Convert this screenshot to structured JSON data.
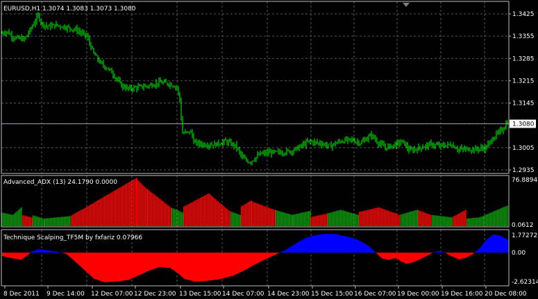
{
  "header": {
    "symbol_label": "EURUSD,H1  1.3074 1.3083 1.3073 1.3080"
  },
  "panes": {
    "adx": {
      "label": "Advanced_ADX (13) 24.1790 0.0000",
      "scale_top": "76.88945",
      "scale_bottom": "0.0612"
    },
    "scalping": {
      "label": "Technique Scalping_TF5M by fxfariz 0.07966",
      "scale_top": "1.77272",
      "scale_mid": "0.00",
      "scale_bottom": "-2.62314"
    }
  },
  "price_axis": {
    "ticks": [
      "1.3425",
      "1.3355",
      "1.3285",
      "1.3215",
      "1.3145",
      "1.3080",
      "1.3005",
      "1.2935"
    ],
    "current_price": "1.3080"
  },
  "time_axis": {
    "labels": [
      "8 Dec 2011",
      "9 Dec 14:00",
      "12 Dec 07:00",
      "12 Dec 23:00",
      "13 Dec 15:00",
      "14 Dec 07:00",
      "14 Dec 23:00",
      "15 Dec 15:00",
      "16 Dec 07:00",
      "19 Dec 00:00",
      "19 Dec 16:00",
      "20 Dec 08:00"
    ]
  },
  "colors": {
    "background": "#000000",
    "grid": "#5a5a5a",
    "candle": "#00ff00",
    "adx_up": "#00a000",
    "adx_down": "#ff0000",
    "scalp_pos": "#0000ff",
    "scalp_neg": "#ff0000",
    "text": "#ffffff"
  },
  "chart_data": [
    {
      "type": "candlestick",
      "title": "EURUSD,H1",
      "ylim": [
        1.2935,
        1.3425
      ],
      "close_path": [
        [
          0,
          1.3362
        ],
        [
          10,
          1.337
        ],
        [
          20,
          1.335
        ],
        [
          35,
          1.3345
        ],
        [
          45,
          1.338
        ],
        [
          55,
          1.342
        ],
        [
          60,
          1.3395
        ],
        [
          70,
          1.3385
        ],
        [
          80,
          1.339
        ],
        [
          95,
          1.3383
        ],
        [
          110,
          1.3375
        ],
        [
          125,
          1.3355
        ],
        [
          135,
          1.33
        ],
        [
          145,
          1.327
        ],
        [
          160,
          1.3245
        ],
        [
          175,
          1.32
        ],
        [
          185,
          1.319
        ],
        [
          200,
          1.3195
        ],
        [
          215,
          1.32
        ],
        [
          230,
          1.321
        ],
        [
          245,
          1.3205
        ],
        [
          255,
          1.3195
        ],
        [
          260,
          1.3145
        ],
        [
          262,
          1.305
        ],
        [
          275,
          1.3055
        ],
        [
          280,
          1.302
        ],
        [
          295,
          1.3015
        ],
        [
          310,
          1.3015
        ],
        [
          325,
          1.3025
        ],
        [
          340,
          1.301
        ],
        [
          350,
          1.297
        ],
        [
          360,
          1.296
        ],
        [
          375,
          1.2985
        ],
        [
          390,
          1.299
        ],
        [
          405,
          1.299
        ],
        [
          420,
          1.2995
        ],
        [
          430,
          1.3005
        ],
        [
          445,
          1.3025
        ],
        [
          460,
          1.302
        ],
        [
          475,
          1.301
        ],
        [
          490,
          1.3025
        ],
        [
          505,
          1.303
        ],
        [
          520,
          1.302
        ],
        [
          535,
          1.3045
        ],
        [
          545,
          1.302
        ],
        [
          555,
          1.3005
        ],
        [
          570,
          1.3015
        ],
        [
          580,
          1.3025
        ],
        [
          590,
          1.2995
        ],
        [
          605,
          1.3005
        ],
        [
          620,
          1.3015
        ],
        [
          635,
          1.301
        ],
        [
          650,
          1.3015
        ],
        [
          660,
          1.3
        ],
        [
          670,
          1.3
        ],
        [
          685,
          1.3
        ],
        [
          700,
          1.3005
        ],
        [
          712,
          1.304
        ],
        [
          720,
          1.3055
        ],
        [
          725,
          1.3065
        ],
        [
          732,
          1.309
        ]
      ]
    },
    {
      "type": "bar",
      "title": "Advanced_ADX (13)",
      "ylim": [
        0.0612,
        76.88945
      ],
      "segments": [
        {
          "from": 0,
          "to": 18,
          "color": "green",
          "v0": 22,
          "v1": 18
        },
        {
          "from": 18,
          "to": 30,
          "color": "green",
          "v0": 18,
          "v1": 30
        },
        {
          "from": 30,
          "to": 45,
          "color": "red",
          "v0": 18,
          "v1": 14
        },
        {
          "from": 45,
          "to": 62,
          "color": "green",
          "v0": 18,
          "v1": 12
        },
        {
          "from": 62,
          "to": 100,
          "color": "green",
          "v0": 12,
          "v1": 16
        },
        {
          "from": 100,
          "to": 120,
          "color": "red",
          "v0": 16,
          "v1": 28
        },
        {
          "from": 120,
          "to": 195,
          "color": "red",
          "v0": 28,
          "v1": 76
        },
        {
          "from": 195,
          "to": 210,
          "color": "red",
          "v0": 76,
          "v1": 60
        },
        {
          "from": 210,
          "to": 245,
          "color": "red",
          "v0": 60,
          "v1": 30
        },
        {
          "from": 245,
          "to": 262,
          "color": "green",
          "v0": 30,
          "v1": 22
        },
        {
          "from": 262,
          "to": 300,
          "color": "red",
          "v0": 30,
          "v1": 52
        },
        {
          "from": 300,
          "to": 330,
          "color": "red",
          "v0": 52,
          "v1": 24
        },
        {
          "from": 330,
          "to": 345,
          "color": "green",
          "v0": 24,
          "v1": 18
        },
        {
          "from": 345,
          "to": 360,
          "color": "red",
          "v0": 30,
          "v1": 40
        },
        {
          "from": 360,
          "to": 380,
          "color": "red",
          "v0": 40,
          "v1": 32
        },
        {
          "from": 380,
          "to": 395,
          "color": "red",
          "v0": 32,
          "v1": 26
        },
        {
          "from": 395,
          "to": 420,
          "color": "green",
          "v0": 26,
          "v1": 18
        },
        {
          "from": 420,
          "to": 445,
          "color": "green",
          "v0": 18,
          "v1": 24
        },
        {
          "from": 445,
          "to": 470,
          "color": "red",
          "v0": 14,
          "v1": 20
        },
        {
          "from": 470,
          "to": 490,
          "color": "green",
          "v0": 20,
          "v1": 26
        },
        {
          "from": 490,
          "to": 515,
          "color": "green",
          "v0": 26,
          "v1": 18
        },
        {
          "from": 515,
          "to": 545,
          "color": "red",
          "v0": 22,
          "v1": 30
        },
        {
          "from": 545,
          "to": 575,
          "color": "red",
          "v0": 30,
          "v1": 18
        },
        {
          "from": 575,
          "to": 600,
          "color": "green",
          "v0": 18,
          "v1": 26
        },
        {
          "from": 600,
          "to": 620,
          "color": "red",
          "v0": 26,
          "v1": 18
        },
        {
          "from": 620,
          "to": 650,
          "color": "green",
          "v0": 18,
          "v1": 14
        },
        {
          "from": 650,
          "to": 670,
          "color": "red",
          "v0": 14,
          "v1": 26
        },
        {
          "from": 670,
          "to": 690,
          "color": "green",
          "v0": 12,
          "v1": 14
        },
        {
          "from": 690,
          "to": 733,
          "color": "green",
          "v0": 14,
          "v1": 34
        }
      ]
    },
    {
      "type": "area",
      "title": "Technique Scalping_TF5M by fxfariz",
      "ylim": [
        -2.62314,
        1.77272
      ],
      "curve": [
        [
          0,
          -0.25
        ],
        [
          15,
          -0.45
        ],
        [
          30,
          -0.6
        ],
        [
          40,
          -0.2
        ],
        [
          45,
          0.1
        ],
        [
          55,
          0.3
        ],
        [
          70,
          0.2
        ],
        [
          85,
          0.05
        ],
        [
          95,
          -0.1
        ],
        [
          105,
          -0.6
        ],
        [
          120,
          -1.4
        ],
        [
          135,
          -2.2
        ],
        [
          150,
          -2.5
        ],
        [
          165,
          -2.45
        ],
        [
          185,
          -2.3
        ],
        [
          200,
          -1.9
        ],
        [
          215,
          -1.5
        ],
        [
          230,
          -1.2
        ],
        [
          245,
          -1.3
        ],
        [
          255,
          -1.7
        ],
        [
          265,
          -2.2
        ],
        [
          280,
          -2.45
        ],
        [
          295,
          -2.4
        ],
        [
          315,
          -2.25
        ],
        [
          335,
          -1.95
        ],
        [
          350,
          -1.55
        ],
        [
          365,
          -1.05
        ],
        [
          380,
          -0.6
        ],
        [
          395,
          -0.2
        ],
        [
          410,
          0.2
        ],
        [
          425,
          0.75
        ],
        [
          440,
          1.25
        ],
        [
          455,
          1.5
        ],
        [
          470,
          1.6
        ],
        [
          485,
          1.55
        ],
        [
          500,
          1.35
        ],
        [
          515,
          1.1
        ],
        [
          530,
          0.6
        ],
        [
          540,
          0.05
        ],
        [
          550,
          -0.5
        ],
        [
          560,
          -0.6
        ],
        [
          570,
          -0.45
        ],
        [
          578,
          -0.75
        ],
        [
          585,
          -0.95
        ],
        [
          595,
          -0.8
        ],
        [
          605,
          -0.55
        ],
        [
          615,
          -0.25
        ],
        [
          625,
          0.05
        ],
        [
          632,
          0.15
        ],
        [
          640,
          0.02
        ],
        [
          650,
          -0.3
        ],
        [
          660,
          -0.55
        ],
        [
          670,
          -0.45
        ],
        [
          680,
          -0.15
        ],
        [
          690,
          0.35
        ],
        [
          700,
          1.05
        ],
        [
          710,
          1.55
        ],
        [
          720,
          1.45
        ],
        [
          733,
          1.05
        ]
      ]
    }
  ]
}
